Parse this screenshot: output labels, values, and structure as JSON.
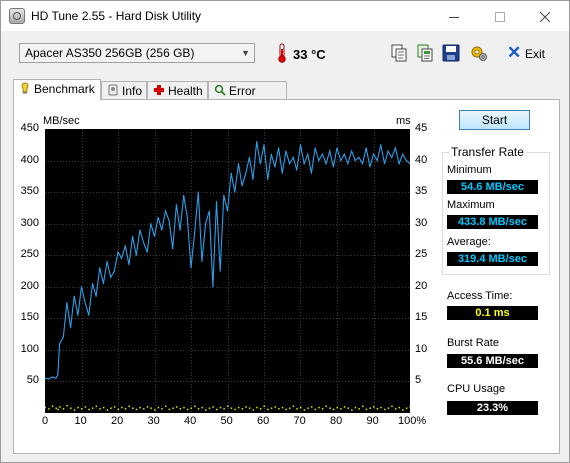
{
  "window": {
    "title": "HD Tune 2.55 - Hard Disk Utility"
  },
  "toolbar": {
    "drive": "Apacer  AS350 256GB (256 GB)",
    "temperature": "33 °C",
    "buttons": [
      "copy-info-icon",
      "copy-all-icon",
      "save-icon",
      "options-icon"
    ],
    "exit_label": "Exit"
  },
  "tabs": [
    {
      "label": "Benchmark",
      "icon": "benchmark-icon",
      "active": true
    },
    {
      "label": "Info",
      "icon": "info-icon"
    },
    {
      "label": "Health",
      "icon": "health-icon"
    },
    {
      "label": "Error Scan",
      "icon": "error-scan-icon"
    }
  ],
  "benchmark": {
    "start_label": "Start",
    "transfer_rate": {
      "title": "Transfer Rate",
      "minimum_label": "Minimum",
      "minimum": "54.6 MB/sec",
      "maximum_label": "Maximum",
      "maximum": "433.8 MB/sec",
      "average_label": "Average:",
      "average": "319.4 MB/sec"
    },
    "access_time_label": "Access Time:",
    "access_time": "0.1 ms",
    "burst_rate_label": "Burst Rate",
    "burst_rate": "55.6 MB/sec",
    "cpu_usage_label": "CPU Usage",
    "cpu_usage": "23.3%"
  },
  "colors": {
    "transfer_line": "#2f9ee8",
    "access_dots": "#e6e600",
    "plot_bg": "#000000",
    "grid": "#3c3c3c",
    "value_cyan": "#00c8ff",
    "value_yellow": "#ffff00",
    "value_white": "#ffffff"
  },
  "chart_data": {
    "type": "line",
    "title": "",
    "left_axis_unit": "MB/sec",
    "right_axis_unit": "ms",
    "xlabel": "",
    "xlim": [
      0,
      100
    ],
    "ylim": [
      0,
      450
    ],
    "y2lim": [
      0,
      45
    ],
    "x_ticks": [
      "0",
      "10",
      "20",
      "30",
      "40",
      "50",
      "60",
      "70",
      "80",
      "90",
      "100%"
    ],
    "y_ticks": [
      "50",
      "100",
      "150",
      "200",
      "250",
      "300",
      "350",
      "400",
      "450"
    ],
    "y2_ticks": [
      "5",
      "10",
      "15",
      "20",
      "25",
      "30",
      "35",
      "40",
      "45"
    ],
    "grid": true,
    "series": [
      {
        "x": [
          0,
          1,
          2,
          3,
          3.5,
          4,
          5,
          6,
          7,
          8,
          9,
          10,
          11,
          12,
          13,
          14,
          15,
          16,
          17,
          18,
          19,
          20,
          21,
          22,
          23,
          24,
          25,
          26,
          27,
          28,
          29,
          30,
          31,
          32,
          33,
          34,
          35,
          36,
          37,
          38,
          39,
          40,
          41,
          42,
          43,
          44,
          45,
          46,
          47,
          48,
          49,
          50,
          51,
          52,
          53,
          54,
          55,
          56,
          57,
          58,
          59,
          60,
          61,
          62,
          63,
          64,
          65,
          66,
          67,
          68,
          69,
          70,
          71,
          72,
          73,
          74,
          75,
          76,
          77,
          78,
          79,
          80,
          81,
          82,
          83,
          84,
          85,
          86,
          87,
          88,
          89,
          90,
          91,
          92,
          93,
          94,
          95,
          96,
          97,
          98,
          99,
          100
        ],
        "y": [
          55,
          54,
          57,
          55,
          60,
          110,
          120,
          175,
          135,
          185,
          155,
          200,
          175,
          155,
          205,
          185,
          230,
          205,
          240,
          215,
          225,
          255,
          245,
          265,
          235,
          280,
          250,
          290,
          270,
          255,
          300,
          280,
          310,
          290,
          320,
          305,
          260,
          330,
          290,
          345,
          310,
          230,
          285,
          350,
          240,
          300,
          320,
          200,
          335,
          225,
          345,
          320,
          380,
          350,
          395,
          360,
          380,
          405,
          370,
          430,
          395,
          425,
          370,
          410,
          390,
          420,
          380,
          415,
          395,
          405,
          385,
          425,
          395,
          410,
          380,
          420,
          400,
          410,
          395,
          415,
          390,
          420,
          400,
          410,
          395,
          415,
          400,
          405,
          395,
          420,
          390,
          410,
          400,
          425,
          395,
          415,
          405,
          420,
          395,
          410,
          400,
          395
        ],
        "access_ms": [
          0.9,
          0.7,
          1.1,
          0.8,
          0.6,
          1.0,
          0.7,
          1.2,
          0.8,
          0.5,
          0.9,
          0.7,
          1.0,
          0.6,
          0.8,
          1.1,
          0.7,
          0.9,
          0.5,
          0.8,
          1.0,
          0.6,
          0.9,
          0.7,
          1.1,
          0.8,
          0.6,
          0.9,
          0.7,
          1.0,
          0.8,
          0.5,
          0.9,
          0.7,
          1.1,
          0.6,
          0.8,
          1.0,
          0.7,
          0.9,
          0.6,
          0.8,
          1.1,
          0.7,
          0.9,
          0.5,
          0.8,
          1.0,
          0.6,
          0.9,
          0.7,
          1.1,
          0.8,
          0.6,
          0.9,
          0.7,
          1.0,
          0.8,
          0.5,
          0.9,
          0.7,
          1.1,
          0.6,
          0.8,
          1.0,
          0.7,
          0.9,
          0.6,
          0.8,
          1.1,
          0.7,
          0.9,
          0.5,
          0.8,
          1.0,
          0.6,
          0.9,
          0.7,
          1.1,
          0.8,
          0.6,
          0.9,
          0.7,
          1.0,
          0.8,
          0.5,
          0.9,
          0.7,
          1.1,
          0.6,
          0.8,
          1.0,
          0.7,
          0.9,
          0.6,
          0.8,
          1.1,
          0.7,
          0.9,
          0.5,
          0.8,
          1.0
        ]
      }
    ]
  }
}
